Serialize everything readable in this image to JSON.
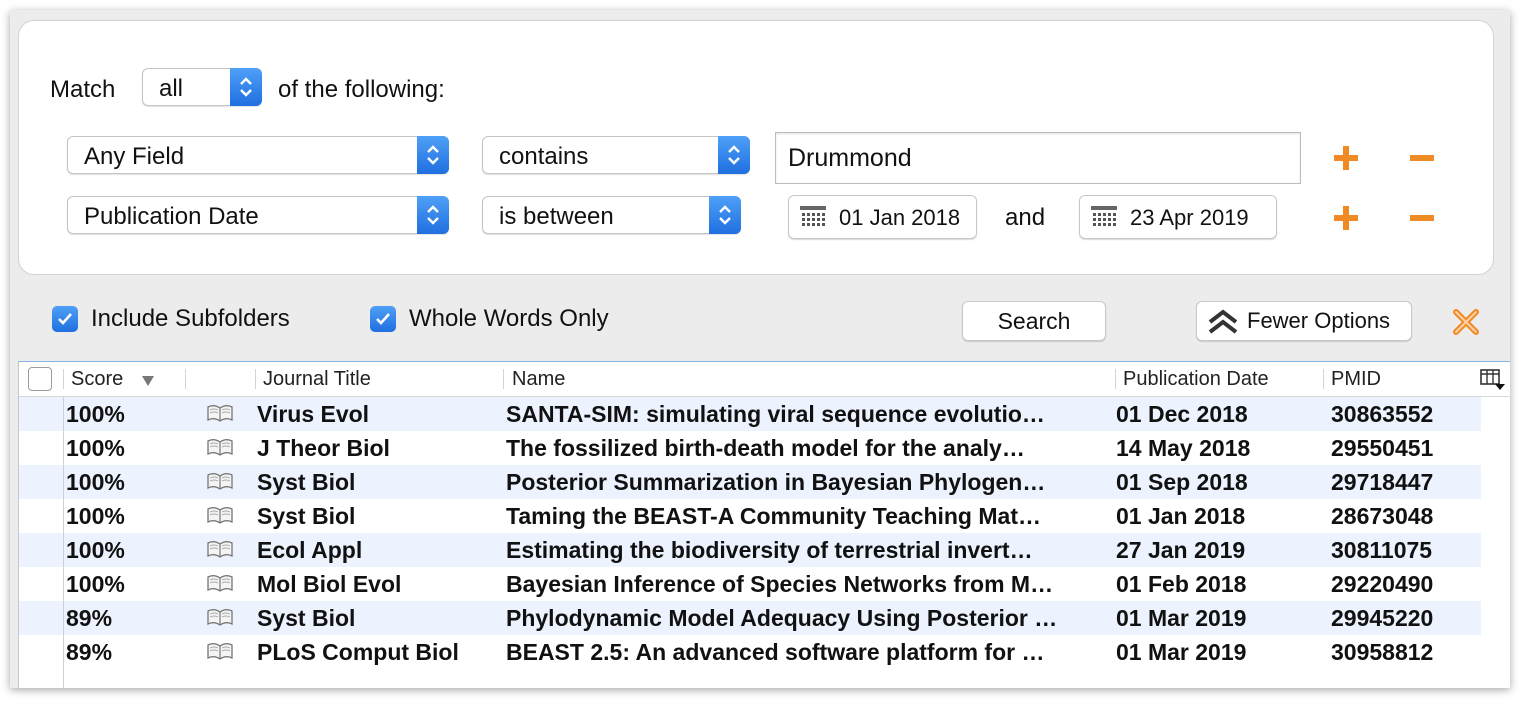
{
  "query": {
    "match_label": "Match",
    "match_value": "all",
    "match_suffix": "of the following:",
    "rows": [
      {
        "field": "Any Field",
        "operator": "contains",
        "value": "Drummond"
      },
      {
        "field": "Publication Date",
        "operator": "is between",
        "date_from": "01 Jan 2018",
        "and_label": "and",
        "date_to": "23 Apr 2019"
      }
    ],
    "colors": {
      "add": "#f08a24",
      "remove": "#f08a24",
      "accent": "#2a7ae8"
    }
  },
  "options": {
    "include_subfolders": {
      "label": "Include Subfolders",
      "checked": true
    },
    "whole_words": {
      "label": "Whole Words Only",
      "checked": true
    },
    "search_label": "Search",
    "fewer_options_label": "Fewer Options",
    "close_icon": "close-x-icon"
  },
  "table": {
    "columns": [
      "Score",
      "Journal Title",
      "Name",
      "Publication Date",
      "PMID"
    ],
    "sort_column": "Score",
    "rows": [
      {
        "score": "100%",
        "journal": "Virus Evol",
        "name": "SANTA-SIM: simulating viral sequence evolutio…",
        "date": "01 Dec 2018",
        "pmid": "30863552"
      },
      {
        "score": "100%",
        "journal": "J Theor Biol",
        "name": "The fossilized birth-death model for the analy…",
        "date": "14 May 2018",
        "pmid": "29550451"
      },
      {
        "score": "100%",
        "journal": "Syst Biol",
        "name": "Posterior Summarization in Bayesian Phylogen…",
        "date": "01 Sep 2018",
        "pmid": "29718447"
      },
      {
        "score": "100%",
        "journal": "Syst Biol",
        "name": "Taming the BEAST-A Community Teaching Mat…",
        "date": "01 Jan 2018",
        "pmid": "28673048"
      },
      {
        "score": "100%",
        "journal": "Ecol Appl",
        "name": "Estimating the biodiversity of terrestrial invert…",
        "date": "27 Jan 2019",
        "pmid": "30811075"
      },
      {
        "score": "100%",
        "journal": "Mol Biol Evol",
        "name": "Bayesian Inference of Species Networks from M…",
        "date": "01 Feb 2018",
        "pmid": "29220490"
      },
      {
        "score": "89%",
        "journal": "Syst Biol",
        "name": "Phylodynamic Model Adequacy Using Posterior …",
        "date": "01 Mar 2019",
        "pmid": "29945220"
      },
      {
        "score": "89%",
        "journal": "PLoS Comput Biol",
        "name": "BEAST 2.5: An advanced software platform for …",
        "date": "01 Mar 2019",
        "pmid": "30958812"
      }
    ]
  }
}
